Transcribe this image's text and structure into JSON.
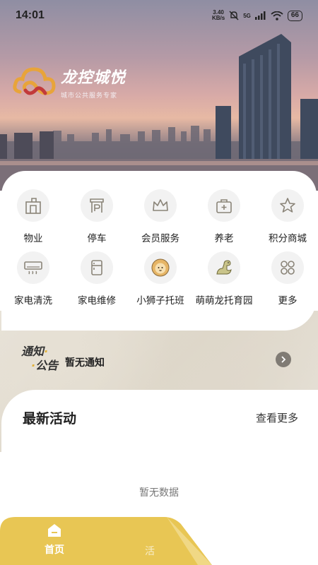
{
  "status_bar": {
    "time": "14:01",
    "net_speed_value": "3.40",
    "net_speed_unit": "KB/s",
    "network": "5G",
    "battery": "66"
  },
  "brand": {
    "name": "龙控城悦",
    "tagline": "城市公共服务专家"
  },
  "services": [
    {
      "label": "物业",
      "icon": "building-icon"
    },
    {
      "label": "停车",
      "icon": "parking-gate-icon"
    },
    {
      "label": "会员服务",
      "icon": "crown-icon"
    },
    {
      "label": "养老",
      "icon": "medical-kit-icon"
    },
    {
      "label": "积分商城",
      "icon": "star-icon"
    },
    {
      "label": "家电清洗",
      "icon": "air-conditioner-icon"
    },
    {
      "label": "家电维修",
      "icon": "fridge-icon"
    },
    {
      "label": "小狮子托班",
      "icon": "lion-icon"
    },
    {
      "label": "萌萌龙托育园",
      "icon": "dinosaur-icon"
    },
    {
      "label": "更多",
      "icon": "more-grid-icon"
    }
  ],
  "notice": {
    "title_line1": "通知",
    "title_line2": "公告",
    "text": "暂无通知"
  },
  "activities": {
    "title": "最新活动",
    "more": "查看更多",
    "empty": "暂无数据"
  },
  "tabs": {
    "home": "首页",
    "second_partial": "活"
  },
  "colors": {
    "accent_yellow": "#e8c654",
    "icon_stroke": "#8a8478"
  }
}
